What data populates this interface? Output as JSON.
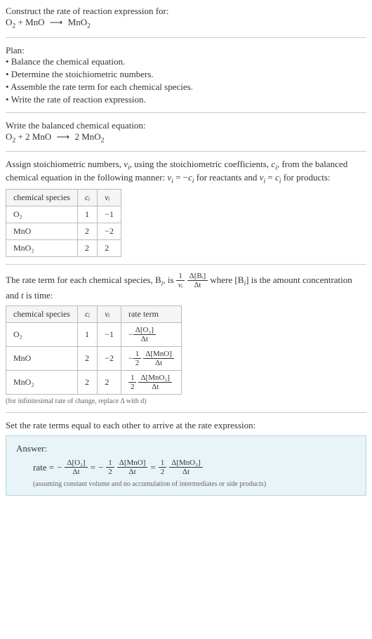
{
  "header": {
    "prompt": "Construct the rate of reaction expression for:",
    "equation_lhs1": "O",
    "equation_lhs1_sub": "2",
    "equation_plus": " + MnO ",
    "equation_arrow": "⟶",
    "equation_rhs": " MnO",
    "equation_rhs_sub": "2"
  },
  "plan": {
    "title": "Plan:",
    "items": [
      "• Balance the chemical equation.",
      "• Determine the stoichiometric numbers.",
      "• Assemble the rate term for each chemical species.",
      "• Write the rate of reaction expression."
    ]
  },
  "balanced": {
    "title": "Write the balanced chemical equation:",
    "lhs1": "O",
    "lhs1_sub": "2",
    "plus1": " + 2 MnO ",
    "arrow": "⟶",
    "rhs": " 2 MnO",
    "rhs_sub": "2"
  },
  "assign": {
    "text1": "Assign stoichiometric numbers, ",
    "nu_i": "ν",
    "nu_i_sub": "i",
    "text2": ", using the stoichiometric coefficients, ",
    "c_i": "c",
    "c_i_sub": "i",
    "text3": ", from the balanced chemical equation in the following manner: ",
    "rel1a": "ν",
    "rel1a_sub": "i",
    "rel1b": " = −",
    "rel1c": "c",
    "rel1c_sub": "i",
    "text4": " for reactants and ",
    "rel2a": "ν",
    "rel2a_sub": "i",
    "rel2b": " = ",
    "rel2c": "c",
    "rel2c_sub": "i",
    "text5": " for products:"
  },
  "table1": {
    "headers": {
      "h1": "chemical species",
      "h2": "cᵢ",
      "h3": "νᵢ"
    },
    "rows": [
      {
        "species": "O₂",
        "c": "1",
        "nu": "−1"
      },
      {
        "species": "MnO",
        "c": "2",
        "nu": "−2"
      },
      {
        "species": "MnO₂",
        "c": "2",
        "nu": "2"
      }
    ]
  },
  "rateterm": {
    "text1": "The rate term for each chemical species, B",
    "sub_i1": "i",
    "text2": ", is ",
    "frac1_num": "1",
    "frac1_den": "νᵢ",
    "frac2_num": "Δ[Bᵢ]",
    "frac2_den": "Δt",
    "text3": " where [B",
    "sub_i2": "i",
    "text4": "] is the amount concentration and ",
    "t": "t",
    "text5": " is time:"
  },
  "table2": {
    "headers": {
      "h1": "chemical species",
      "h2": "cᵢ",
      "h3": "νᵢ",
      "h4": "rate term"
    },
    "rows": [
      {
        "species": "O₂",
        "c": "1",
        "nu": "−1",
        "neg": "−",
        "coef_num": "",
        "coef_den": "",
        "d_num": "Δ[O₂]",
        "d_den": "Δt"
      },
      {
        "species": "MnO",
        "c": "2",
        "nu": "−2",
        "neg": "−",
        "coef_num": "1",
        "coef_den": "2",
        "d_num": "Δ[MnO]",
        "d_den": "Δt"
      },
      {
        "species": "MnO₂",
        "c": "2",
        "nu": "2",
        "neg": "",
        "coef_num": "1",
        "coef_den": "2",
        "d_num": "Δ[MnO₂]",
        "d_den": "Δt"
      }
    ],
    "footnote": "(for infinitesimal rate of change, replace Δ with d)"
  },
  "final": {
    "title": "Set the rate terms equal to each other to arrive at the rate expression:"
  },
  "answer": {
    "label": "Answer:",
    "rate": "rate = ",
    "t1_neg": "−",
    "t1_num": "Δ[O₂]",
    "t1_den": "Δt",
    "eq1": " = ",
    "t2_neg": "−",
    "t2_cnum": "1",
    "t2_cden": "2",
    "t2_num": "Δ[MnO]",
    "t2_den": "Δt",
    "eq2": " = ",
    "t3_cnum": "1",
    "t3_cden": "2",
    "t3_num": "Δ[MnO₂]",
    "t3_den": "Δt",
    "note": "(assuming constant volume and no accumulation of intermediates or side products)"
  },
  "chart_data": {
    "type": "table",
    "tables": [
      {
        "title": "Stoichiometric numbers",
        "columns": [
          "chemical species",
          "c_i",
          "nu_i"
        ],
        "rows": [
          [
            "O2",
            1,
            -1
          ],
          [
            "MnO",
            2,
            -2
          ],
          [
            "MnO2",
            2,
            2
          ]
        ]
      },
      {
        "title": "Rate terms",
        "columns": [
          "chemical species",
          "c_i",
          "nu_i",
          "rate term"
        ],
        "rows": [
          [
            "O2",
            1,
            -1,
            "-Δ[O2]/Δt"
          ],
          [
            "MnO",
            2,
            -2,
            "-(1/2)Δ[MnO]/Δt"
          ],
          [
            "MnO2",
            2,
            2,
            "(1/2)Δ[MnO2]/Δt"
          ]
        ]
      }
    ]
  }
}
